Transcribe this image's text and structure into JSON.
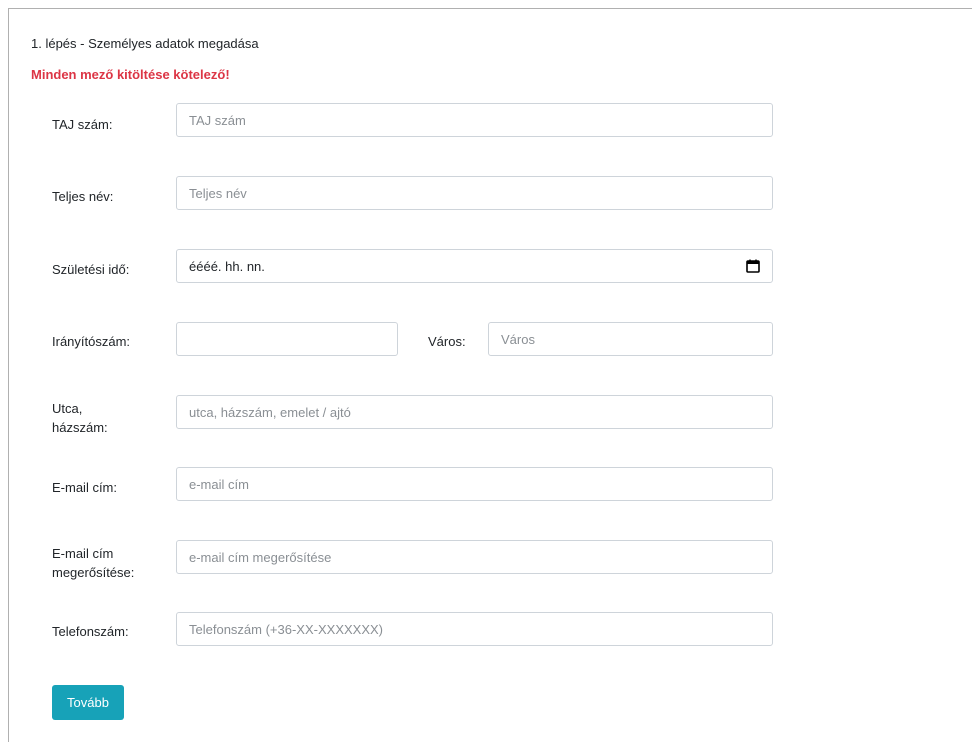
{
  "form": {
    "step_title": "1. lépés - Személyes adatok megadása",
    "required_note": "Minden mező kitöltése kötelező!",
    "taj": {
      "label": "TAJ szám:",
      "placeholder": "TAJ szám"
    },
    "full_name": {
      "label": "Teljes név:",
      "placeholder": "Teljes név"
    },
    "birth_date": {
      "label": "Születési idő:",
      "value": "éééé. hh. nn.",
      "icon": "calendar-icon"
    },
    "zip": {
      "label": "Irányítószám:",
      "placeholder": ""
    },
    "city": {
      "label": "Város:",
      "placeholder": "Város"
    },
    "street": {
      "label_line1": "Utca,",
      "label_line2": "házszám:",
      "placeholder": "utca, házszám, emelet / ajtó"
    },
    "email": {
      "label": "E-mail cím:",
      "placeholder": "e-mail cím"
    },
    "email_confirm": {
      "label_line1": "E-mail cím",
      "label_line2": "megerősítése:",
      "placeholder": "e-mail cím megerősítése"
    },
    "phone": {
      "label": "Telefonszám:",
      "placeholder": "Telefonszám (+36-XX-XXXXXXX)"
    },
    "submit_label": "Tovább"
  },
  "colors": {
    "required_note": "#dc3545",
    "button": "#17a2b8",
    "input_border": "#ced4da"
  }
}
